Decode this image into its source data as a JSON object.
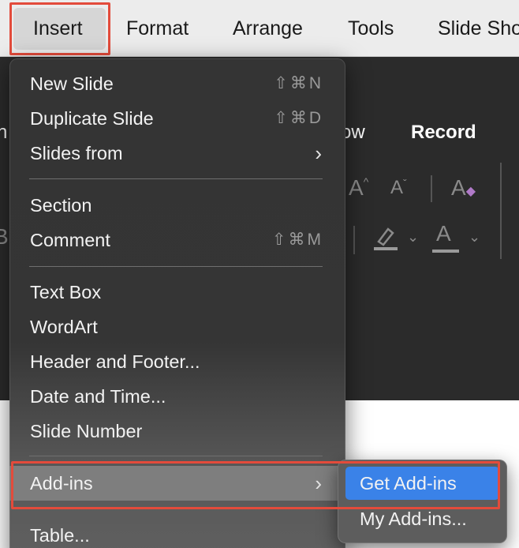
{
  "menubar": {
    "items": [
      "Insert",
      "Format",
      "Arrange",
      "Tools",
      "Slide Sho"
    ]
  },
  "ribbon": {
    "tab_partial_left": "n",
    "tab_partial_show": "ow",
    "tab_record": "Record",
    "partial_left_glyph": "B",
    "font_size_up": "A",
    "font_size_down": "A",
    "clear_format": "A",
    "font_color": "A"
  },
  "insert_menu": {
    "items": [
      {
        "label": "New Slide",
        "shortcut": "⇧⌘N"
      },
      {
        "label": "Duplicate Slide",
        "shortcut": "⇧⌘D"
      },
      {
        "label": "Slides from",
        "arrow": "›"
      },
      {
        "label": "Section"
      },
      {
        "label": "Comment",
        "shortcut": "⇧⌘M"
      },
      {
        "label": "Text Box"
      },
      {
        "label": "WordArt"
      },
      {
        "label": "Header and Footer..."
      },
      {
        "label": "Date and Time..."
      },
      {
        "label": "Slide Number"
      },
      {
        "label": "Add-ins",
        "arrow": "›"
      },
      {
        "label": "Table..."
      }
    ]
  },
  "addins_submenu": {
    "items": [
      "Get Add-ins",
      "My Add-ins..."
    ]
  },
  "colors": {
    "highlight_red": "#e34b3b",
    "selection_blue": "#3a82e8"
  }
}
